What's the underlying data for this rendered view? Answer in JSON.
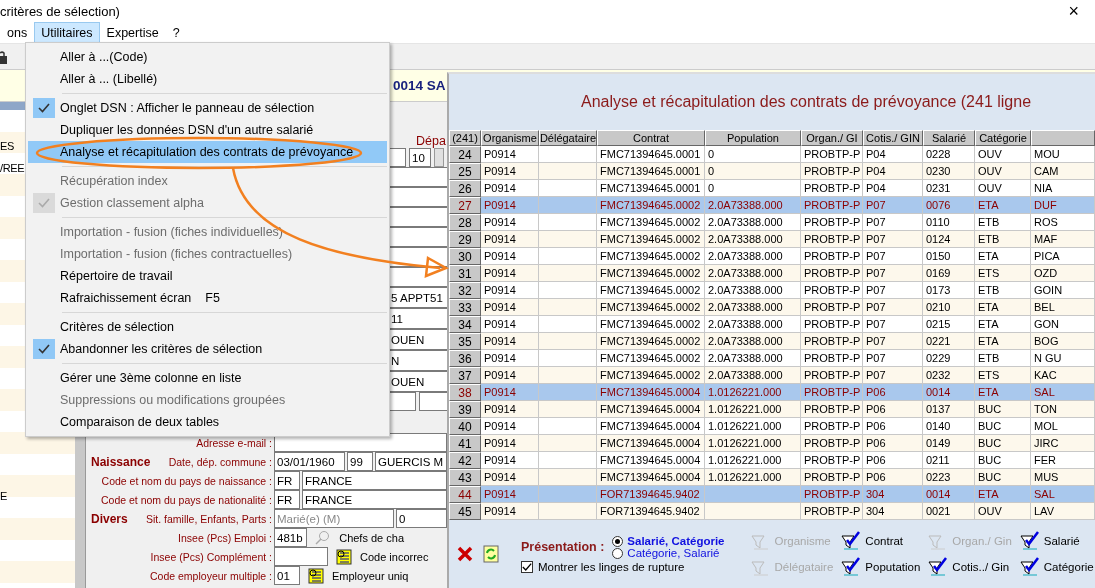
{
  "window": {
    "title": "critères de sélection)",
    "close": "×"
  },
  "menubar": [
    {
      "label": "ons",
      "selected": false
    },
    {
      "label": "Utilitaires",
      "selected": true
    },
    {
      "label": "Expertise",
      "selected": false
    },
    {
      "label": "?",
      "selected": false
    }
  ],
  "header": {
    "text": "0014 SA"
  },
  "sidebar": {
    "items": [
      "ES",
      "/REE",
      "E"
    ]
  },
  "form": {
    "top_label": "Dépa",
    "top_field": "10",
    "column_fields": [
      "5 APPT51",
      "11",
      "OUEN",
      "N",
      "OUEN"
    ],
    "rows": [
      {
        "label": "Adresse e-mail :",
        "fields": [
          {
            "kind": "input"
          }
        ]
      },
      {
        "section": "Naissance",
        "label": "Date, dép. commune :",
        "fields": [
          {
            "kind": "input",
            "value": "03/01/1960"
          },
          {
            "kind": "input",
            "value": "99"
          },
          {
            "kind": "input",
            "value": "GUERCIS M"
          }
        ]
      },
      {
        "label": "Code et nom du pays de naissance :",
        "fields": [
          {
            "kind": "input",
            "value": "FR"
          },
          {
            "kind": "input",
            "value": "FRANCE"
          }
        ]
      },
      {
        "label": "Code et nom du pays de nationalité :",
        "fields": [
          {
            "kind": "input",
            "value": "FR"
          },
          {
            "kind": "input",
            "value": "FRANCE"
          }
        ]
      },
      {
        "section": "Divers",
        "label": "Sit. famille, Enfants, Parts :",
        "fields": [
          {
            "kind": "select",
            "value": "Marié(e) (M)",
            "disabled": true
          },
          {
            "kind": "input",
            "value": "0"
          }
        ]
      },
      {
        "label": "Insee (Pcs) Emploi :",
        "fields": [
          {
            "kind": "input",
            "value": "481b"
          }
        ],
        "lookup": {
          "kind": "disabled",
          "text": "Chefs de cha"
        }
      },
      {
        "label": "Insee (Pcs) Complément :",
        "fields": [
          {
            "kind": "input"
          }
        ],
        "lookup": {
          "kind": "active",
          "text": "Code incorrec"
        }
      },
      {
        "label": "Code employeur multiple :",
        "fields": [
          {
            "kind": "input",
            "value": "01"
          }
        ],
        "lookup": {
          "kind": "active",
          "text": "Employeur uniq"
        }
      }
    ]
  },
  "menu": {
    "items": [
      {
        "kind": "item",
        "label": "Aller à ...(Code)",
        "checked": false,
        "disabled": false,
        "selected": false
      },
      {
        "kind": "item",
        "label": "Aller à ... (Libellé)",
        "checked": false,
        "disabled": false,
        "selected": false
      },
      {
        "kind": "separator"
      },
      {
        "kind": "item",
        "label": "Onglet DSN : Afficher le panneau de sélection",
        "checked": true,
        "disabled": false,
        "selected": false
      },
      {
        "kind": "item",
        "label": "Dupliquer les données DSN d'un autre salarié",
        "checked": false,
        "disabled": false,
        "selected": false
      },
      {
        "kind": "item",
        "label": "Analyse et récapitulation des contrats de prévoyance",
        "checked": false,
        "disabled": false,
        "selected": true
      },
      {
        "kind": "separator"
      },
      {
        "kind": "item",
        "label": "Récupération index",
        "checked": false,
        "disabled": true,
        "selected": false
      },
      {
        "kind": "item",
        "label": "Gestion classement alpha",
        "checked": true,
        "disabled": true,
        "selected": false
      },
      {
        "kind": "separator"
      },
      {
        "kind": "item",
        "label": "Importation - fusion (fiches individuelles)",
        "checked": false,
        "disabled": true,
        "selected": false
      },
      {
        "kind": "item",
        "label": "Importation - fusion (fiches contractuelles)",
        "checked": false,
        "disabled": true,
        "selected": false
      },
      {
        "kind": "item",
        "label": "Répertoire de travail",
        "checked": false,
        "disabled": false,
        "selected": false
      },
      {
        "kind": "item",
        "label": "Rafraichissement écran",
        "shortcut": "F5",
        "checked": false,
        "disabled": false,
        "selected": false
      },
      {
        "kind": "separator"
      },
      {
        "kind": "item",
        "label": "Critères de sélection",
        "checked": false,
        "disabled": false,
        "selected": false
      },
      {
        "kind": "item",
        "label": "Abandonner les critères de sélection",
        "checked": true,
        "disabled": false,
        "selected": false
      },
      {
        "kind": "separator"
      },
      {
        "kind": "item",
        "label": "Gérer une 3ème colonne en liste",
        "checked": false,
        "disabled": false,
        "selected": false
      },
      {
        "kind": "item",
        "label": "Suppressions ou modifications groupées",
        "checked": false,
        "disabled": true,
        "selected": false
      },
      {
        "kind": "item",
        "label": "Comparaison de deux tables",
        "checked": false,
        "disabled": false,
        "selected": false
      }
    ]
  },
  "dialog": {
    "title": "Analyse et récapitulation des contrats de prévoyance (241 ligne",
    "table": {
      "columns": [
        "(241)",
        "Organisme",
        "Délégataire",
        "Contrat",
        "Population",
        "Organ./ GI",
        "Cotis./ GIN",
        "Salarié",
        "Catégorie"
      ],
      "rows": [
        {
          "number": "24",
          "organisme": "P0914",
          "contrat": "FMC71394645.0001",
          "population": "0",
          "organ_gin": "PROBTP-P",
          "cotis_gin": "P04",
          "salarie": "0228",
          "categorie": "OUV",
          "column_10": "MOU",
          "selected": false
        },
        {
          "number": "25",
          "organisme": "P0914",
          "contrat": "FMC71394645.0001",
          "population": "0",
          "organ_gin": "PROBTP-P",
          "cotis_gin": "P04",
          "salarie": "0230",
          "categorie": "OUV",
          "column_10": "CAM",
          "selected": false
        },
        {
          "number": "26",
          "organisme": "P0914",
          "contrat": "FMC71394645.0001",
          "population": "0",
          "organ_gin": "PROBTP-P",
          "cotis_gin": "P04",
          "salarie": "0231",
          "categorie": "OUV",
          "column_10": "NIA",
          "selected": false
        },
        {
          "number": "27",
          "organisme": "P0914",
          "contrat": "FMC71394645.0002",
          "population": "2.0A73388.000",
          "organ_gin": "PROBTP-P",
          "cotis_gin": "P07",
          "salarie": "0076",
          "categorie": "ETA",
          "column_10": "DUF",
          "selected": true
        },
        {
          "number": "28",
          "organisme": "P0914",
          "contrat": "FMC71394645.0002",
          "population": "2.0A73388.000",
          "organ_gin": "PROBTP-P",
          "cotis_gin": "P07",
          "salarie": "0110",
          "categorie": "ETB",
          "column_10": "ROS",
          "selected": false
        },
        {
          "number": "29",
          "organisme": "P0914",
          "contrat": "FMC71394645.0002",
          "population": "2.0A73388.000",
          "organ_gin": "PROBTP-P",
          "cotis_gin": "P07",
          "salarie": "0124",
          "categorie": "ETB",
          "column_10": "MAF",
          "selected": false
        },
        {
          "number": "30",
          "organisme": "P0914",
          "contrat": "FMC71394645.0002",
          "population": "2.0A73388.000",
          "organ_gin": "PROBTP-P",
          "cotis_gin": "P07",
          "salarie": "0150",
          "categorie": "ETA",
          "column_10": "PICA",
          "selected": false
        },
        {
          "number": "31",
          "organisme": "P0914",
          "contrat": "FMC71394645.0002",
          "population": "2.0A73388.000",
          "organ_gin": "PROBTP-P",
          "cotis_gin": "P07",
          "salarie": "0169",
          "categorie": "ETS",
          "column_10": "OZD",
          "selected": false
        },
        {
          "number": "32",
          "organisme": "P0914",
          "contrat": "FMC71394645.0002",
          "population": "2.0A73388.000",
          "organ_gin": "PROBTP-P",
          "cotis_gin": "P07",
          "salarie": "0173",
          "categorie": "ETB",
          "column_10": "GOIN",
          "selected": false
        },
        {
          "number": "33",
          "organisme": "P0914",
          "contrat": "FMC71394645.0002",
          "population": "2.0A73388.000",
          "organ_gin": "PROBTP-P",
          "cotis_gin": "P07",
          "salarie": "0210",
          "categorie": "ETA",
          "column_10": "BEL",
          "selected": false
        },
        {
          "number": "34",
          "organisme": "P0914",
          "contrat": "FMC71394645.0002",
          "population": "2.0A73388.000",
          "organ_gin": "PROBTP-P",
          "cotis_gin": "P07",
          "salarie": "0215",
          "categorie": "ETA",
          "column_10": "GON",
          "selected": false
        },
        {
          "number": "35",
          "organisme": "P0914",
          "contrat": "FMC71394645.0002",
          "population": "2.0A73388.000",
          "organ_gin": "PROBTP-P",
          "cotis_gin": "P07",
          "salarie": "0221",
          "categorie": "ETA",
          "column_10": "BOG",
          "selected": false
        },
        {
          "number": "36",
          "organisme": "P0914",
          "contrat": "FMC71394645.0002",
          "population": "2.0A73388.000",
          "organ_gin": "PROBTP-P",
          "cotis_gin": "P07",
          "salarie": "0229",
          "categorie": "ETB",
          "column_10": "N GU",
          "selected": false
        },
        {
          "number": "37",
          "organisme": "P0914",
          "contrat": "FMC71394645.0002",
          "population": "2.0A73388.000",
          "organ_gin": "PROBTP-P",
          "cotis_gin": "P07",
          "salarie": "0232",
          "categorie": "ETS",
          "column_10": "KAC",
          "selected": false
        },
        {
          "number": "38",
          "organisme": "P0914",
          "contrat": "FMC71394645.0004",
          "population": "1.0126221.000",
          "organ_gin": "PROBTP-P",
          "cotis_gin": "P06",
          "salarie": "0014",
          "categorie": "ETA",
          "column_10": "SAL",
          "selected": true
        },
        {
          "number": "39",
          "organisme": "P0914",
          "contrat": "FMC71394645.0004",
          "population": "1.0126221.000",
          "organ_gin": "PROBTP-P",
          "cotis_gin": "P06",
          "salarie": "0137",
          "categorie": "BUC",
          "column_10": "TON",
          "selected": false
        },
        {
          "number": "40",
          "organisme": "P0914",
          "contrat": "FMC71394645.0004",
          "population": "1.0126221.000",
          "organ_gin": "PROBTP-P",
          "cotis_gin": "P06",
          "salarie": "0140",
          "categorie": "BUC",
          "column_10": "MOL",
          "selected": false
        },
        {
          "number": "41",
          "organisme": "P0914",
          "contrat": "FMC71394645.0004",
          "population": "1.0126221.000",
          "organ_gin": "PROBTP-P",
          "cotis_gin": "P06",
          "salarie": "0149",
          "categorie": "BUC",
          "column_10": "JIRC",
          "selected": false
        },
        {
          "number": "42",
          "organisme": "P0914",
          "contrat": "FMC71394645.0004",
          "population": "1.0126221.000",
          "organ_gin": "PROBTP-P",
          "cotis_gin": "P06",
          "salarie": "0211",
          "categorie": "BUC",
          "column_10": "FER",
          "selected": false
        },
        {
          "number": "43",
          "organisme": "P0914",
          "contrat": "FMC71394645.0004",
          "population": "1.0126221.000",
          "organ_gin": "PROBTP-P",
          "cotis_gin": "P06",
          "salarie": "0223",
          "categorie": "BUC",
          "column_10": "MUS",
          "selected": false
        },
        {
          "number": "44",
          "organisme": "P0914",
          "contrat": "FOR71394645.9402",
          "organ_gin": "PROBTP-P",
          "cotis_gin": "304",
          "salarie": "0014",
          "categorie": "ETA",
          "column_10": "SAL",
          "selected": true
        },
        {
          "number": "45",
          "organisme": "P0914",
          "contrat": "FOR71394645.9402",
          "organ_gin": "PROBTP-P",
          "cotis_gin": "304",
          "salarie": "0021",
          "categorie": "OUV",
          "column_10": "LAV",
          "selected": false
        }
      ]
    },
    "presentation": {
      "label": "Présentation :",
      "options": [
        {
          "label": "Salarié, Catégorie",
          "selected": true
        },
        {
          "label": "Catégorie, Salarié",
          "selected": false
        }
      ],
      "rupture": {
        "label": "Montrer les linges de rupture",
        "checked": true
      }
    },
    "filters": [
      {
        "label": "Organisme",
        "enabled": false
      },
      {
        "label": "Délégataire",
        "enabled": false
      },
      {
        "label": "Contrat",
        "enabled": true
      },
      {
        "label": "Poputation",
        "enabled": true
      },
      {
        "label": "Organ./ Gin",
        "enabled": false
      },
      {
        "label": "Cotis../ Gin",
        "enabled": true
      },
      {
        "label": "Salarié",
        "enabled": true
      },
      {
        "label": "Catégorie",
        "enabled": true
      }
    ]
  }
}
